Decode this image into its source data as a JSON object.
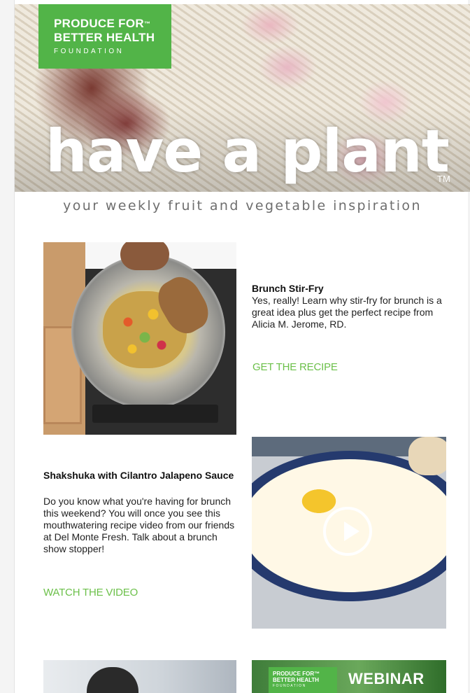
{
  "header": {
    "logo": {
      "line1": "PRODUCE FOR",
      "tm": "™",
      "line2": "BETTER HEALTH",
      "line3": "FOUNDATION"
    },
    "title": "have a plant",
    "title_tm": "TM",
    "tagline": "your weekly fruit and vegetable inspiration"
  },
  "articles": [
    {
      "title": "Brunch Stir-Fry",
      "body": "Yes, really! Learn why stir-fry for brunch is a great idea plus get the perfect recipe from Alicia M. Jerome, RD.",
      "cta": "GET THE RECIPE"
    },
    {
      "title": "Shakshuka with Cilantro Jalapeno Sauce",
      "body": "Do you know what you're having for brunch this weekend? You will once you see this mouthwatering recipe video from our friends at Del Monte Fresh. Talk about a brunch show stopper!",
      "cta": "WATCH THE VIDEO"
    }
  ],
  "webinar_banner": {
    "logo_line1": "PRODUCE FOR",
    "logo_tm": "™",
    "logo_line2": "BETTER HEALTH",
    "logo_line3": "FOUNDATION",
    "label": "WEBINAR"
  },
  "colors": {
    "brand_green": "#52b448",
    "cta_green": "#6cc04a"
  }
}
